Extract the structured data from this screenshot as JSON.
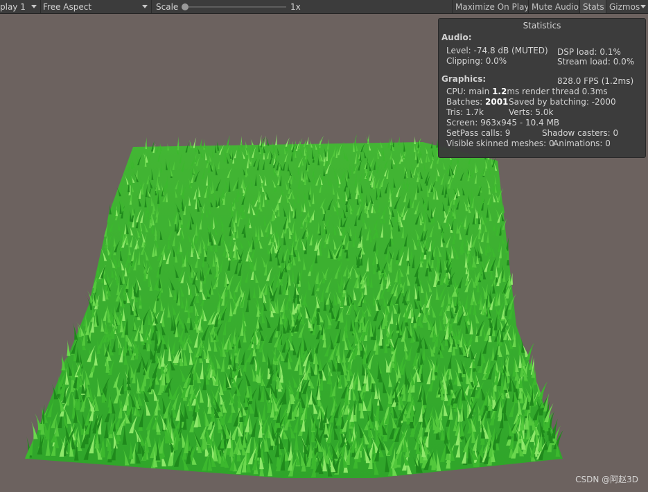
{
  "toolbar": {
    "display_label": "play 1",
    "aspect_label": "Free Aspect",
    "scale_label": "Scale",
    "scale_value": "1x",
    "scale_fraction": 0.0,
    "buttons": {
      "maximize": "Maximize On Play",
      "mute": "Mute Audio",
      "stats": "Stats",
      "gizmos": "Gizmos"
    }
  },
  "stats": {
    "title": "Statistics",
    "audio_header": "Audio:",
    "level": "Level: -74.8 dB (MUTED)",
    "clipping": "Clipping: 0.0%",
    "dsp_load": "DSP load: 0.1%",
    "stream_load": "Stream load: 0.0%",
    "graphics_header": "Graphics:",
    "fps": "828.0 FPS (1.2ms)",
    "cpu_prefix": "CPU: main ",
    "cpu_main": "1.2",
    "cpu_suffix": "ms  render thread 0.3ms",
    "batches_prefix": "Batches: ",
    "batches": "2001",
    "saved_batching": "Saved by batching: -2000",
    "tris": "Tris: 1.7k",
    "verts": "Verts: 5.0k",
    "screen": "Screen: 963x945 - 10.4 MB",
    "setpass": "SetPass calls: 9",
    "shadow_casters": "Shadow casters: 0",
    "skinned": "Visible skinned meshes: 0",
    "animations": "Animations: 0"
  },
  "watermark": "CSDN @阿赵3D",
  "colors": {
    "viewport_bg": "#6c625f",
    "grass_dark": "#1f8a1c",
    "grass_mid": "#3cb82e",
    "grass_light": "#8ee86a",
    "toolbar_bg": "#3c3c3c",
    "stats_bg": "#3a3a3a"
  }
}
